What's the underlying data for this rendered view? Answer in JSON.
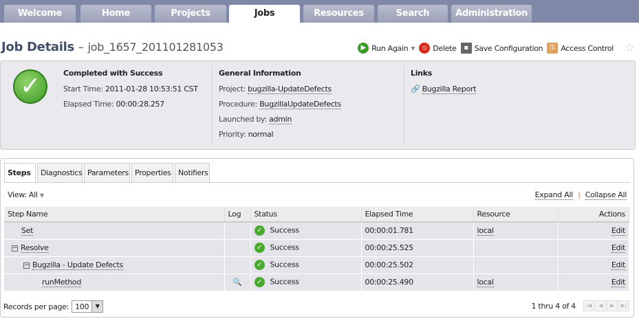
{
  "nav": {
    "tabs": [
      "Welcome",
      "Home",
      "Projects",
      "Jobs",
      "Resources",
      "Search",
      "Administration"
    ],
    "active": "Jobs"
  },
  "header": {
    "title": "Job Details",
    "separator": "–",
    "job_name": "job_1657_201101281053"
  },
  "actions": {
    "run_again": "Run Again",
    "delete": "Delete",
    "save_config": "Save Configuration",
    "access_control": "Access Control"
  },
  "summary": {
    "status": "Completed with Success",
    "start_label": "Start Time:",
    "start": "2011-01-28 10:53:51 CST",
    "elapsed_label": "Elapsed Time:",
    "elapsed": "00:00:28.257"
  },
  "general": {
    "title": "General Information",
    "project_label": "Project:",
    "project": "bugzilla-UpdateDefects",
    "procedure_label": "Procedure:",
    "procedure": "BugzillaUpdateDefects",
    "launched_label": "Launched by:",
    "launched": "admin",
    "priority_label": "Priority:",
    "priority": "normal"
  },
  "links": {
    "title": "Links",
    "items": [
      "Bugzilla Report"
    ]
  },
  "subtabs": [
    "Steps",
    "Diagnostics",
    "Parameters",
    "Properties",
    "Notifiers"
  ],
  "view": {
    "label": "View:",
    "value": "All",
    "expand": "Expand All",
    "collapse": "Collapse All"
  },
  "table": {
    "headers": [
      "Step Name",
      "Log",
      "Status",
      "Elapsed Time",
      "Resource",
      "Actions"
    ],
    "rows": [
      {
        "name": "Set",
        "status": "Success",
        "elapsed": "00:00:01.781",
        "resource": "local",
        "action": "Edit"
      },
      {
        "name": "Resolve",
        "status": "Success",
        "elapsed": "00:00:25.525",
        "resource": "",
        "action": "Edit"
      },
      {
        "name": "Bugzilla - Update Defects",
        "status": "Success",
        "elapsed": "00:00:25.502",
        "resource": "",
        "action": "Edit"
      },
      {
        "name": "runMethod",
        "status": "Success",
        "elapsed": "00:00:25.490",
        "resource": "local",
        "action": "Edit"
      }
    ]
  },
  "footer": {
    "records_label": "Records per page:",
    "records": "100",
    "range": "1 thru 4 of 4"
  }
}
